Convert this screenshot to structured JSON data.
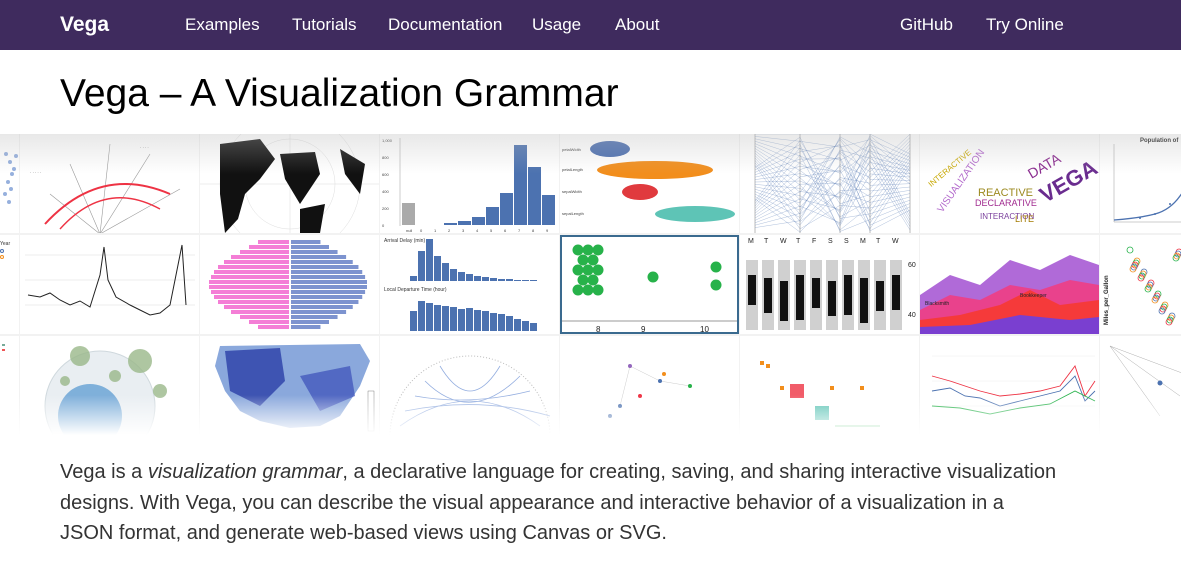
{
  "nav": {
    "brand": "Vega",
    "links": [
      "Examples",
      "Tutorials",
      "Documentation",
      "Usage",
      "About"
    ],
    "right_links": [
      "GitHub",
      "Try Online"
    ]
  },
  "page_title": "Vega – A Visualization Grammar",
  "intro": {
    "part1": "Vega is a ",
    "emphasis": "visualization grammar",
    "part2": ", a declarative language for creating, saving, and sharing interactive visualization designs. With Vega, you can describe the visual appearance and interactive behavior of a visualization in a JSON format, and generate web-based views using Canvas or SVG."
  },
  "gallery": {
    "thumb_labels": {
      "histogram_y_ticks": [
        "1,000",
        "800",
        "600",
        "400",
        "200",
        "0"
      ],
      "histogram_x_ticks": [
        "null",
        "0",
        "1",
        "2",
        "3",
        "4",
        "5",
        "6",
        "7",
        "8",
        "9"
      ],
      "violin_labels": [
        "petalWidth",
        "petalLength",
        "sepalWidth",
        "sepalLength"
      ],
      "weekday_labels": [
        "M",
        "T",
        "W",
        "T",
        "F",
        "S",
        "S",
        "M",
        "T",
        "W"
      ],
      "weekday_y_ticks": [
        "60",
        "40"
      ],
      "dot_x_ticks": [
        "8",
        "9",
        "10"
      ],
      "histogram2_titles": [
        "Arrival Delay (min)",
        "Local Departure Time (hour)"
      ],
      "wordcloud_words": [
        "VEGA",
        "DATA",
        "REACTIVE",
        "DECLARATIVE",
        "VISUALIZATION",
        "INTERACTIVE",
        "INTERACTION",
        "LITE"
      ],
      "population_title": "Population of",
      "mpg_label": "Miles_per_Gallon",
      "year_label": "Year",
      "stream_labels": [
        "Blacksmith",
        "Bookkeeper"
      ]
    }
  },
  "colors": {
    "nav_bg": "#3f2b5e",
    "accent_blue": "#4c72b0",
    "pink": "#f47ed6",
    "green": "#27b24a"
  }
}
